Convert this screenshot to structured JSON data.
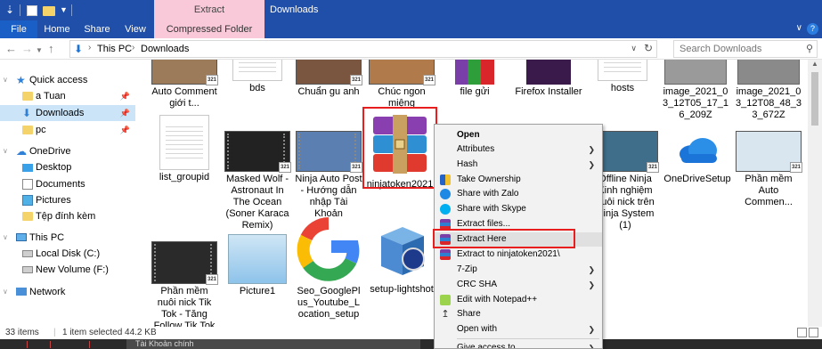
{
  "window": {
    "title": "Downloads",
    "context_tab": "Extract"
  },
  "ribbon": {
    "tabs": [
      "File",
      "Home",
      "Share",
      "View",
      "Compressed Folder Tools"
    ]
  },
  "address": {
    "crumbs": [
      "This PC",
      "Downloads"
    ],
    "search_placeholder": "Search Downloads"
  },
  "navpane": {
    "items": [
      {
        "label": "Quick access",
        "icon": "star-icon"
      },
      {
        "label": "a Tuan",
        "icon": "folder-icon",
        "pinned": true
      },
      {
        "label": "Downloads",
        "icon": "download-icon",
        "pinned": true,
        "selected": true
      },
      {
        "label": "pc",
        "icon": "folder-icon",
        "pinned": true
      },
      {
        "label": "OneDrive",
        "icon": "cloud-icon"
      },
      {
        "label": "Desktop",
        "icon": "desktop-icon"
      },
      {
        "label": "Documents",
        "icon": "document-icon"
      },
      {
        "label": "Pictures",
        "icon": "picture-icon"
      },
      {
        "label": "Tệp đính kèm",
        "icon": "folder-icon"
      },
      {
        "label": "This PC",
        "icon": "computer-icon"
      },
      {
        "label": "Local Disk (C:)",
        "icon": "disk-icon"
      },
      {
        "label": "New Volume (F:)",
        "icon": "disk-icon"
      },
      {
        "label": "Network",
        "icon": "network-icon"
      }
    ]
  },
  "files": {
    "row1": [
      "Auto Comment giới t...",
      "bds",
      "Chuẩn gu anh",
      "Chúc ngon miệng",
      "file gửi",
      "Firefox Installer",
      "hosts",
      "image_2021_03_12T05_17_16_209Z",
      "image_2021_03_12T08_48_33_672Z"
    ],
    "row2": [
      "list_groupid",
      "Masked Wolf - Astronaut In The Ocean (Soner Karaca Remix)",
      "Ninja Auto Post - Hướng dẫn nhập Tài Khoản",
      "ninjatoken2021",
      "Offline Ninja Kinh nghiệm nuôi nick trên Ninja System (1)",
      "OneDriveSetup",
      "Phần mềm Auto Commen..."
    ],
    "row3": [
      "Phần mềm nuôi nick Tik Tok - Tăng Follow Tik Tok",
      "Picture1",
      "Seo_GooglePlus_Youtube_Location_setup",
      "setup-lightshot"
    ],
    "badge": "321"
  },
  "context_menu": {
    "items": [
      "Open",
      "Attributes",
      "Hash",
      "Take Ownership",
      "Share with Zalo",
      "Share with Skype",
      "Extract files...",
      "Extract Here",
      "Extract to ninjatoken2021\\",
      "7-Zip",
      "CRC SHA",
      "Edit with Notepad++",
      "Share",
      "Open with",
      "Give access to"
    ]
  },
  "status": {
    "count": "33 items",
    "selection": "1 item selected  44.2 KB"
  },
  "taskbar": {
    "window_label": "Tài Khoản chính"
  },
  "colors": {
    "titlebar": "#1f4fa8",
    "context_tab": "#f9c9d9",
    "selection": "#cce4f7",
    "highlight_box": "#e81d1d"
  }
}
